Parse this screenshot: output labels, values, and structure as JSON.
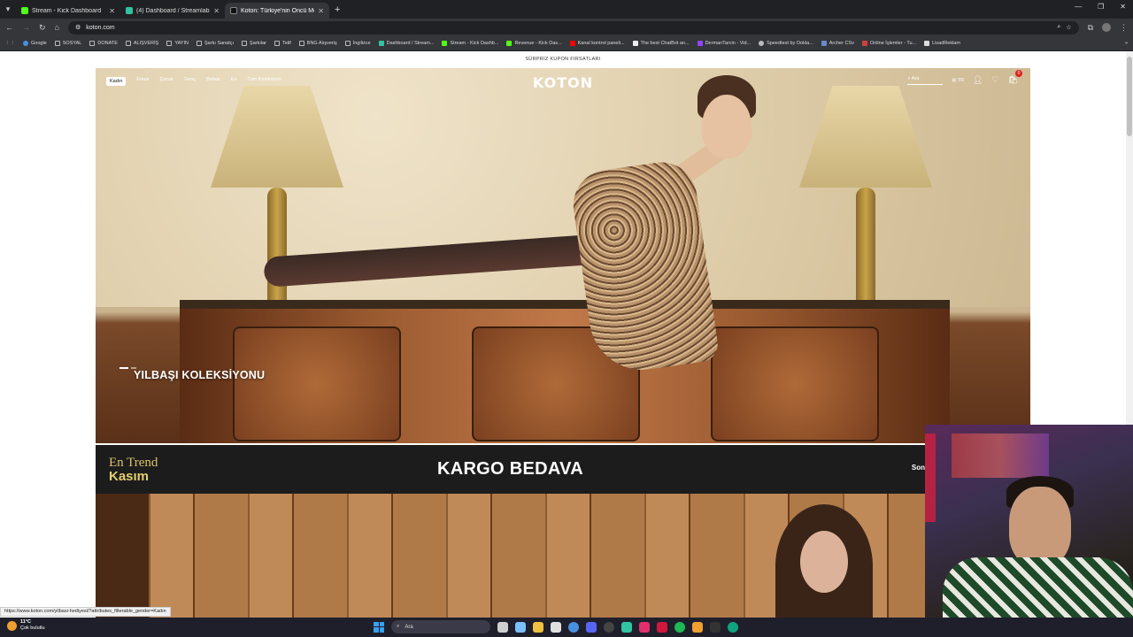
{
  "browser": {
    "tabs": [
      {
        "label": "Stream - Kick Dashboard",
        "favicon_color": "#53fc18",
        "active": false
      },
      {
        "label": "(4) Dashboard / Streamlabs",
        "favicon_color": "#31c3a2",
        "active": false
      },
      {
        "label": "Koton: Türkiye'nin Öncü Moda",
        "favicon_color": "#111111",
        "active": true
      }
    ],
    "new_tab": "+",
    "url": "koton.com",
    "bookmarks": [
      {
        "label": "Google",
        "icon": "google-icon"
      },
      {
        "label": "SOSYAL",
        "icon": "folder-icon"
      },
      {
        "label": "DONATE",
        "icon": "folder-icon"
      },
      {
        "label": "ALIŞVERİŞ",
        "icon": "folder-icon"
      },
      {
        "label": "YAYIN",
        "icon": "folder-icon"
      },
      {
        "label": "Şarkı Sanatçı",
        "icon": "folder-icon"
      },
      {
        "label": "Şarkılar",
        "icon": "folder-icon"
      },
      {
        "label": "Telif",
        "icon": "folder-icon"
      },
      {
        "label": "BNG Alışveriş",
        "icon": "folder-icon"
      },
      {
        "label": "İngilizce",
        "icon": "folder-icon"
      },
      {
        "label": "Dashboard / Stream...",
        "icon": "streamlabs-icon"
      },
      {
        "label": "Stream - Kick Dashb...",
        "icon": "kick-icon"
      },
      {
        "label": "Revenue - Kick Das...",
        "icon": "kick-icon"
      },
      {
        "label": "Kanal kontrol paneli...",
        "icon": "youtube-icon"
      },
      {
        "label": "The best ChatBot an...",
        "icon": "chatbot-icon"
      },
      {
        "label": "DermanTarcin - Vid...",
        "icon": "twitch-icon"
      },
      {
        "label": "Speedtest by Ookla...",
        "icon": "speedtest-icon"
      },
      {
        "label": "Archer CSv",
        "icon": "archer-icon"
      },
      {
        "label": "Online İşlemler - Tu...",
        "icon": "online-icon"
      },
      {
        "label": "LivadReklam",
        "icon": "livad-icon"
      }
    ]
  },
  "site": {
    "promo": "SÜRPRİZ KUPON FIRSATLARI",
    "logo": "KOTON",
    "nav": [
      "Kadın",
      "Erkek",
      "Çocuk",
      "Genç",
      "Bebek",
      "Ev",
      "Tüm Koleksiyon"
    ],
    "search_placeholder": "Ara",
    "lang": "TR",
    "cart_count": "0",
    "hero_title": "YILBAŞI KOLEKSİYONU",
    "trend_line1": "En Trend",
    "trend_line2": "Kasım",
    "shipping": "KARGO BEDAVA",
    "next_text": "Son"
  },
  "status_url": "https://www.koton.com/yilbasi-hediyesi/?attributes_filterable_gender=Kadın",
  "taskbar": {
    "temp": "11°C",
    "weather": "Çok bulutlu",
    "search": "Ara",
    "apps": [
      {
        "name": "task-view-icon",
        "color": "#cfcfcf"
      },
      {
        "name": "copilot-icon",
        "color": "#7ac0ff"
      },
      {
        "name": "file-explorer-icon",
        "color": "#f0c040"
      },
      {
        "name": "calendar-icon",
        "color": "#e0e0e0"
      },
      {
        "name": "chrome-icon",
        "color": "#4a90e2"
      },
      {
        "name": "discord-icon",
        "color": "#5865f2"
      },
      {
        "name": "obs-icon",
        "color": "#444444"
      },
      {
        "name": "streamlabs-icon",
        "color": "#31c3a2"
      },
      {
        "name": "instagram-icon",
        "color": "#e1306c"
      },
      {
        "name": "xmind-icon",
        "color": "#d0183c"
      },
      {
        "name": "spotify-icon",
        "color": "#1db954"
      },
      {
        "name": "cloud-icon",
        "color": "#f0a030"
      },
      {
        "name": "terminal-icon",
        "color": "#333333"
      },
      {
        "name": "chatgpt-icon",
        "color": "#10a37f"
      }
    ]
  }
}
